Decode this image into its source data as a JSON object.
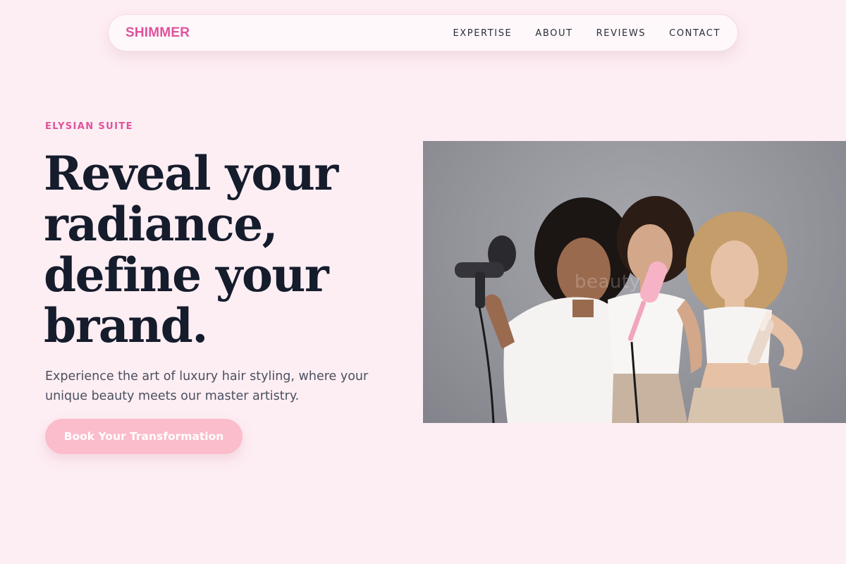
{
  "nav": {
    "logo": "SHIMMER",
    "links": [
      "EXPERTISE",
      "ABOUT",
      "REVIEWS",
      "CONTACT"
    ]
  },
  "hero": {
    "eyebrow": "ELYSIAN SUITE",
    "headline_lines": [
      "Reveal your",
      "radiance,",
      "define your",
      "brand."
    ],
    "subtext": "Experience the art of luxury hair styling, where your unique beauty meets our master artistry.",
    "cta_label": "Book Your Transformation",
    "image": {
      "subject": "three-women-with-hair-styling-tools",
      "watermark": "beauty"
    }
  },
  "colors": {
    "background": "#fdeef3",
    "accent": "#e0529c",
    "heading": "#151c2c",
    "cta": "#fbbccb"
  }
}
